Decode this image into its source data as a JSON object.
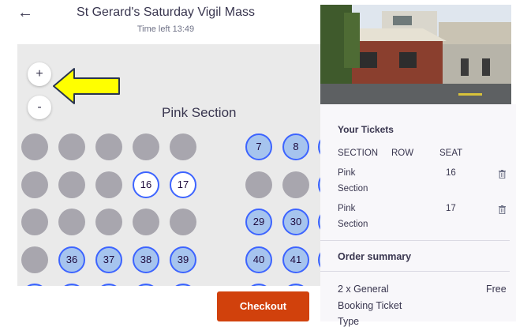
{
  "header": {
    "back_icon": "arrow-left-icon",
    "title": "St Gerard's Saturday Vigil Mass",
    "time_left": "Time left 13:49"
  },
  "map": {
    "zoom_in_label": "+",
    "zoom_out_label": "-",
    "section_title": "Pink Section",
    "seats": {
      "s7": "7",
      "s8": "8",
      "s16": "16",
      "s17": "17",
      "s29": "29",
      "s30": "30",
      "s36": "36",
      "s37": "37",
      "s38": "38",
      "s39": "39",
      "s40": "40",
      "s41": "41"
    },
    "annotation_icon": "yellow-arrow-icon"
  },
  "sidebar": {
    "your_tickets": "Your Tickets",
    "columns": [
      "SECTION",
      "ROW",
      "SEAT"
    ],
    "tickets": [
      {
        "section_line1": "Pink",
        "section_line2": "Section",
        "row": "",
        "seat": "16"
      },
      {
        "section_line1": "Pink",
        "section_line2": "Section",
        "row": "",
        "seat": "17"
      }
    ],
    "order_summary": "Order summary",
    "order_line1": "2 x General",
    "order_line2": "Booking Ticket",
    "order_line3": "Type",
    "order_price": "Free"
  },
  "footer": {
    "checkout_label": "Checkout"
  },
  "colors": {
    "accent": "#3d64ff",
    "checkout": "#d1410c",
    "unavailable_seat": "#a8a6ae",
    "available_seat": "#a6c4ee",
    "annotation": "#ffff00"
  }
}
